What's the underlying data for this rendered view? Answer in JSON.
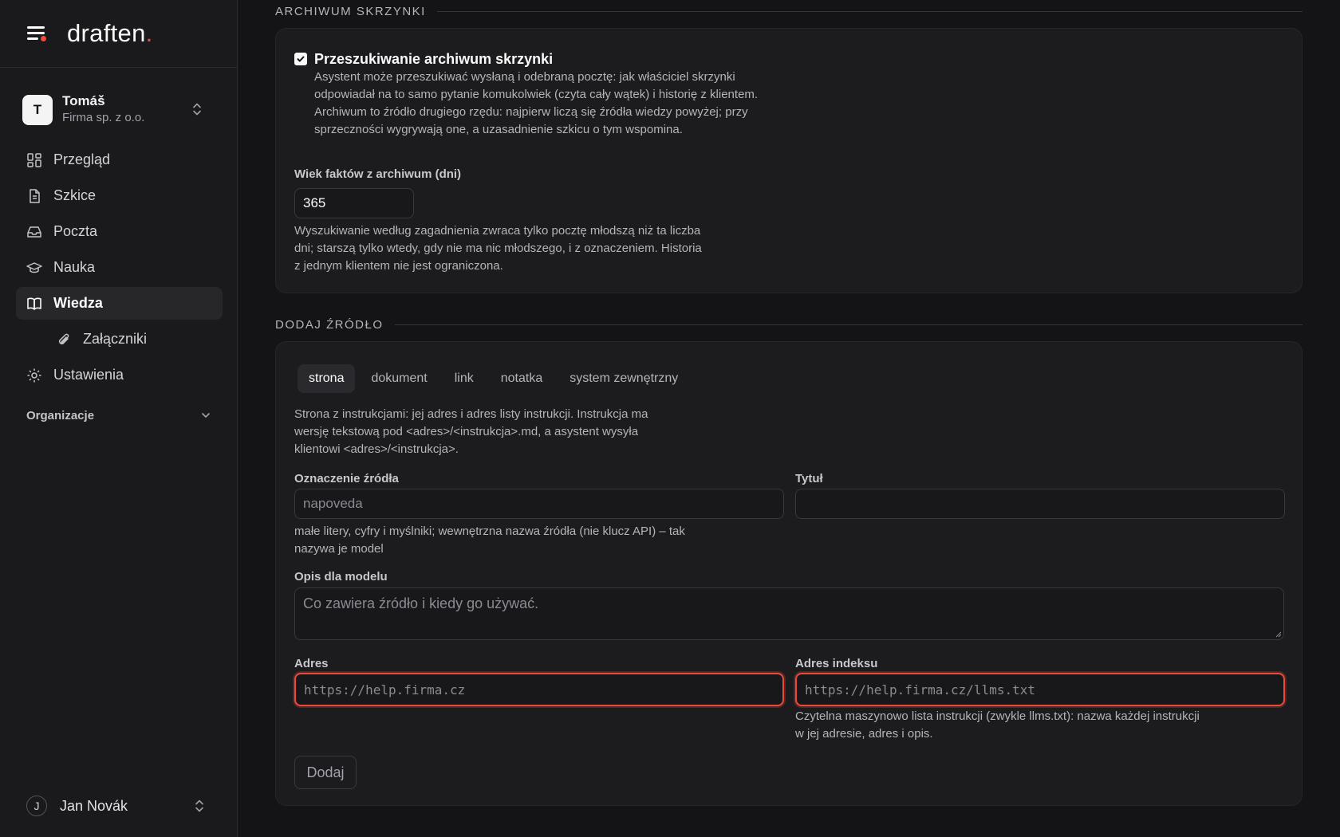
{
  "app": {
    "logo_text": "draften",
    "logo_dot": ".",
    "accent": "#ef4a3c"
  },
  "org": {
    "initial": "T",
    "name": "Tomáš",
    "company": "Firma sp. z o.o."
  },
  "nav": {
    "items": [
      {
        "label": "Przegląd",
        "icon": "dashboard-icon"
      },
      {
        "label": "Szkice",
        "icon": "document-icon"
      },
      {
        "label": "Poczta",
        "icon": "inbox-icon"
      },
      {
        "label": "Nauka",
        "icon": "graduation-cap-icon"
      },
      {
        "label": "Wiedza",
        "icon": "book-icon",
        "active": true
      },
      {
        "label": "Załączniki",
        "icon": "paperclip-icon",
        "sub": true
      },
      {
        "label": "Ustawienia",
        "icon": "gear-icon"
      }
    ],
    "group_label": "Organizacje"
  },
  "user": {
    "initial": "J",
    "name": "Jan Novák"
  },
  "archive": {
    "section_title": "ARCHIWUM SKRZYNKI",
    "checkbox_label": "Przeszukiwanie archiwum skrzynki",
    "checkbox_checked": true,
    "description": "Asystent może przeszukiwać wysłaną i odebraną pocztę: jak właściciel skrzynki odpowiadał na to samo pytanie komukolwiek (czyta cały wątek) i historię z klientem. Archiwum to źródło drugiego rzędu: najpierw liczą się źródła wiedzy powyżej; przy sprzeczności wygrywają one, a uzasadnienie szkicu o tym wspomina.",
    "age_label": "Wiek faktów z archiwum (dni)",
    "age_value": "365",
    "age_help": "Wyszukiwanie według zagadnienia zwraca tylko pocztę młodszą niż ta liczba dni; starszą tylko wtedy, gdy nie ma nic młodszego, i z oznaczeniem. Historia z jednym klientem nie jest ograniczona."
  },
  "add_source": {
    "section_title": "DODAJ ŹRÓDŁO",
    "tabs": [
      "strona",
      "dokument",
      "link",
      "notatka",
      "system zewnętrzny"
    ],
    "active_tab": "strona",
    "intro": "Strona z instrukcjami: jej adres i adres listy instrukcji. Instrukcja ma wersję tekstową pod <adres>/<instrukcja>.md, a asystent wysyła klientowi <adres>/<instrukcja>.",
    "source_id_label": "Oznaczenie źródła",
    "source_id_placeholder": "napoveda",
    "source_id_help": "małe litery, cyfry i myślniki; wewnętrzna nazwa źródła (nie klucz API) – tak nazywa je model",
    "title_label": "Tytuł",
    "title_value": "",
    "desc_label": "Opis dla modelu",
    "desc_placeholder": "Co zawiera źródło i kiedy go używać.",
    "address_label": "Adres",
    "address_placeholder": "https://help.firma.cz",
    "index_label": "Adres indeksu",
    "index_placeholder": "https://help.firma.cz/llms.txt",
    "index_help": "Czytelna maszynowo lista instrukcji (zwykle llms.txt): nazwa każdej instrukcji w jej adresie, adres i opis.",
    "submit_label": "Dodaj",
    "highlight_color": "#ea4a3a"
  }
}
